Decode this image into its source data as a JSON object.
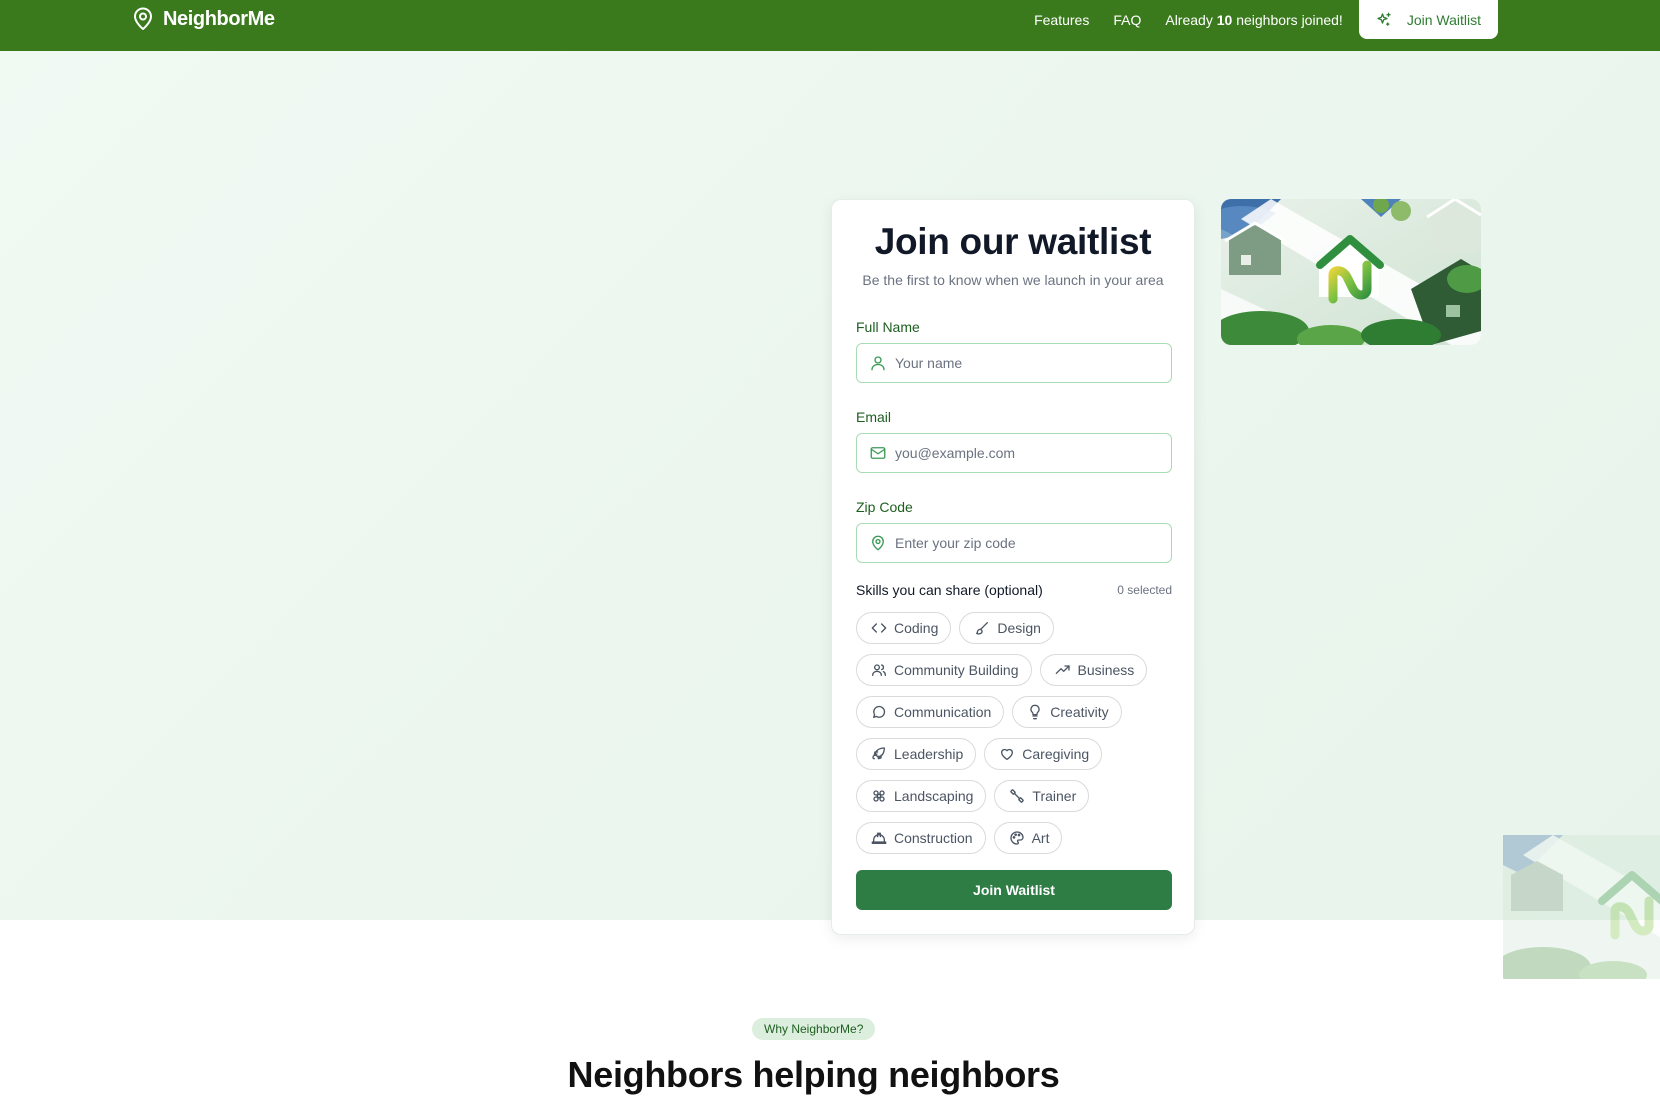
{
  "navbar": {
    "brand": "NeighborMe",
    "links": [
      "Features",
      "FAQ"
    ],
    "joined_prefix": "Already",
    "joined_count": "10",
    "joined_suffix": "neighbors joined!",
    "cta_label": "Join Waitlist",
    "background": "#3a7a1d"
  },
  "form": {
    "title": "Join our waitlist",
    "subtitle": "Be the first to know when we launch in your area",
    "name_label": "Full Name",
    "name_placeholder": "Your name",
    "email_label": "Email",
    "email_placeholder": "you@example.com",
    "zip_label": "Zip Code",
    "zip_placeholder": "Enter your zip code",
    "skills_label": "Skills you can share (optional)",
    "skills_selected": "0 selected",
    "skills": [
      {
        "label": "Coding",
        "icon": "code-icon"
      },
      {
        "label": "Design",
        "icon": "brush-icon"
      },
      {
        "label": "Community Building",
        "icon": "users-icon"
      },
      {
        "label": "Business",
        "icon": "trending-up-icon"
      },
      {
        "label": "Communication",
        "icon": "chat-icon"
      },
      {
        "label": "Creativity",
        "icon": "lightbulb-icon"
      },
      {
        "label": "Leadership",
        "icon": "rocket-icon"
      },
      {
        "label": "Caregiving",
        "icon": "heart-icon"
      },
      {
        "label": "Landscaping",
        "icon": "flower-icon"
      },
      {
        "label": "Trainer",
        "icon": "dumbbell-icon"
      },
      {
        "label": "Construction",
        "icon": "hard-hat-icon"
      },
      {
        "label": "Art",
        "icon": "palette-icon"
      }
    ],
    "submit_label": "Join Waitlist",
    "accent": "#2e7d45"
  },
  "features": {
    "badge": "Why NeighborMe?",
    "title": "Neighbors helping neighbors"
  }
}
